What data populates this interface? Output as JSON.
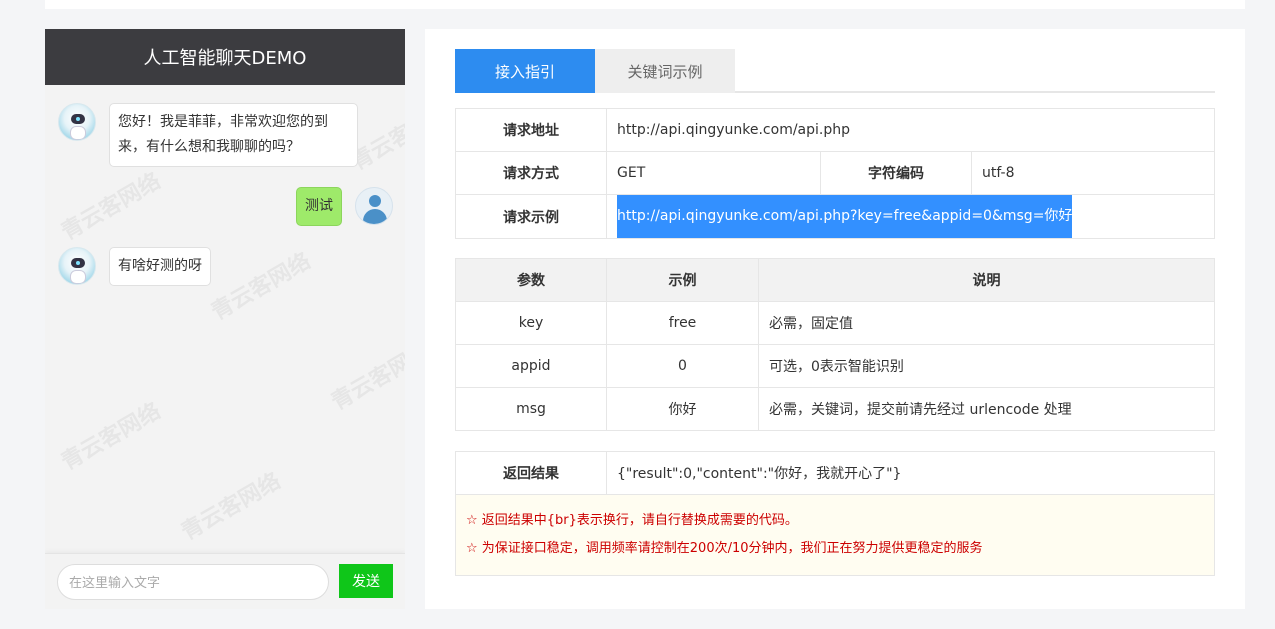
{
  "chat": {
    "title": "人工智能聊天DEMO",
    "watermark": "青云客网络",
    "messages": [
      {
        "from": "bot",
        "text": "您好！我是菲菲，非常欢迎您的到来，有什么想和我聊聊的吗？"
      },
      {
        "from": "user",
        "text": "测试"
      },
      {
        "from": "bot",
        "text": "有啥好测的呀"
      }
    ],
    "input_placeholder": "在这里输入文字",
    "send_label": "发送"
  },
  "doc": {
    "tabs": [
      {
        "label": "接入指引",
        "active": true
      },
      {
        "label": "关键词示例",
        "active": false
      }
    ],
    "request": {
      "url_label": "请求地址",
      "url": "http://api.qingyunke.com/api.php",
      "method_label": "请求方式",
      "method": "GET",
      "charset_label": "字符编码",
      "charset": "utf-8",
      "example_label": "请求示例",
      "example": "http://api.qingyunke.com/api.php?key=free&appid=0&msg=你好"
    },
    "params": {
      "headers": [
        "参数",
        "示例",
        "说明"
      ],
      "rows": [
        [
          "key",
          "free",
          "必需，固定值"
        ],
        [
          "appid",
          "0",
          "可选，0表示智能识别"
        ],
        [
          "msg",
          "你好",
          "必需，关键词，提交前请先经过 urlencode 处理"
        ]
      ]
    },
    "result": {
      "label": "返回结果",
      "value": "{\"result\":0,\"content\":\"你好，我就开心了\"}",
      "notes": [
        "☆ 返回结果中{br}表示换行，请自行替换成需要的代码。",
        "☆ 为保证接口稳定，调用频率请控制在200次/10分钟内，我们正在努力提供更稳定的服务"
      ]
    }
  },
  "colors": {
    "chat_header": "#3c3c40",
    "tab_active": "#2d8cf0",
    "send_button": "#0fc619",
    "user_bubble": "#9eea6a",
    "highlight": "#3390ff",
    "note_text": "#cc0000"
  }
}
